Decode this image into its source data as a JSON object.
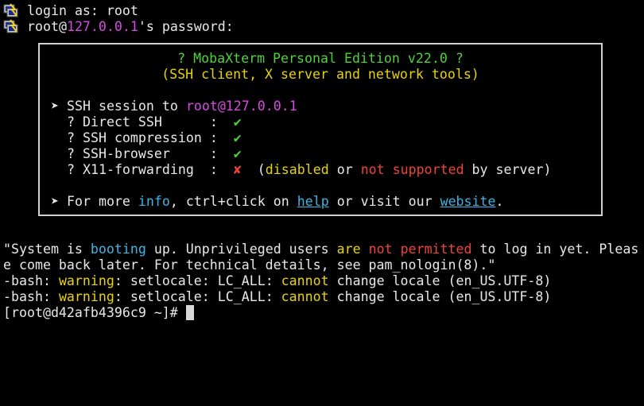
{
  "window": {
    "type": "terminal"
  },
  "login": {
    "prompt": "login as: root",
    "user": "root@",
    "host": "127.0.0.1",
    "suffix": "'s password:"
  },
  "banner": {
    "title": "? MobaXterm Personal Edition v22.0 ?",
    "subtitle": "(SSH client, X server and network tools)",
    "session_bullet": "➤",
    "session_label": " SSH session to ",
    "session_target": "root@127.0.0.1",
    "features": [
      {
        "prefix": "? Direct SSH      :  ",
        "mark": "✔",
        "status": "ok"
      },
      {
        "prefix": "? SSH compression :  ",
        "mark": "✔",
        "status": "ok"
      },
      {
        "prefix": "? SSH-browser     :  ",
        "mark": "✔",
        "status": "ok"
      },
      {
        "prefix": "? X11-forwarding  :  ",
        "mark": "✘",
        "status": "fail"
      }
    ],
    "x11_note": {
      "open": "  (",
      "disabled": "disabled",
      "or": " or ",
      "not_supported": "not supported",
      "tail": " by server)"
    },
    "info": {
      "bullet": "➤",
      "part1": " For more ",
      "info_word": "info",
      "part2": ", ctrl+click on ",
      "help_link": "help",
      "part3": " or visit our ",
      "website_link": "website",
      "part4": "."
    }
  },
  "system_msg": {
    "p1": "\"System is ",
    "booting": "booting",
    "p2": " up. Unprivileged users ",
    "are": "are",
    "p3": " ",
    "not": "not",
    "p4": " ",
    "permitted": "permitted",
    "p5": " to log in yet. Pleas",
    "line2": "e come back later. For technical details, see pam_nologin(8).\""
  },
  "warnings": [
    {
      "p1": "-bash: ",
      "warning": "warning",
      "p2": ": setlocale: LC_ALL: ",
      "cannot": "cannot",
      "p3": " change locale (en_US.UTF-8)"
    },
    {
      "p1": "-bash: ",
      "warning": "warning",
      "p2": ": setlocale: LC_ALL: ",
      "cannot": "cannot",
      "p3": " change locale (en_US.UTF-8)"
    }
  ],
  "prompt": {
    "text": "[root@d42afb4396c9 ~]# "
  },
  "colors": {
    "background": "#000000",
    "foreground": "#e8e8e8",
    "magenta": "#d74adf",
    "yellow": "#e8d400",
    "green": "#4ed23a",
    "red": "#f0413a",
    "cyan": "#3ab6e6"
  },
  "icons": {
    "session_icon": "putty-terminal-icon"
  }
}
